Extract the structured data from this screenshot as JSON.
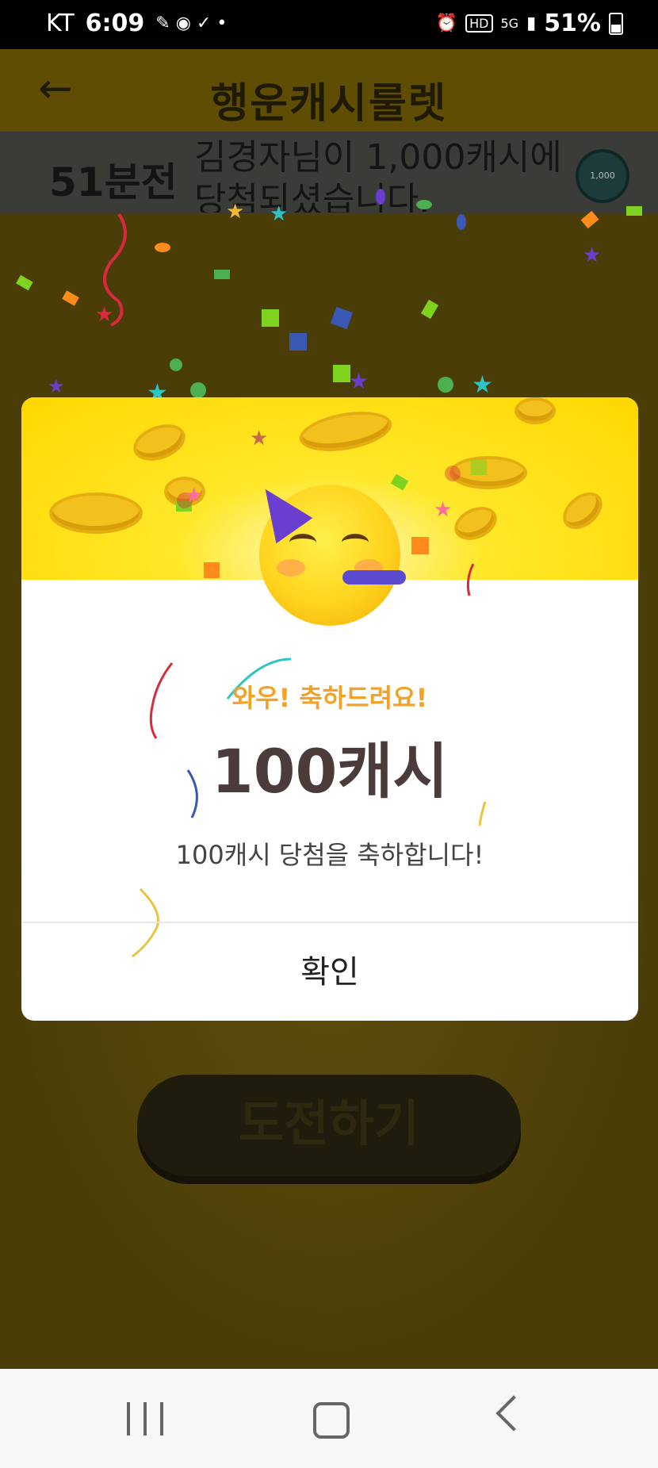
{
  "status_bar": {
    "carrier": "KT",
    "time": "6:09",
    "network": "5G",
    "battery": "51%"
  },
  "app": {
    "title": "행운캐시룰렛",
    "ticker": {
      "time_ago": "51분전",
      "message": "김경자님이 1,000캐시에 당첨되셨습니다.",
      "badge": "1,000"
    },
    "challenge_button": "도전하기"
  },
  "dialog": {
    "headline": "와우! 축하드려요!",
    "amount": "100캐시",
    "description": "100캐시 당첨을 축하합니다!",
    "confirm_label": "확인"
  },
  "icons": {
    "back": "arrow-left-icon",
    "nav_recent": "recent-apps-icon",
    "nav_home": "home-icon",
    "nav_back": "chevron-left-icon"
  },
  "colors": {
    "banner_yellow": "#ffd700",
    "headline_orange": "#f3a228",
    "amount_text": "#4b3b3b",
    "dim_overlay": "#4a3d08"
  }
}
